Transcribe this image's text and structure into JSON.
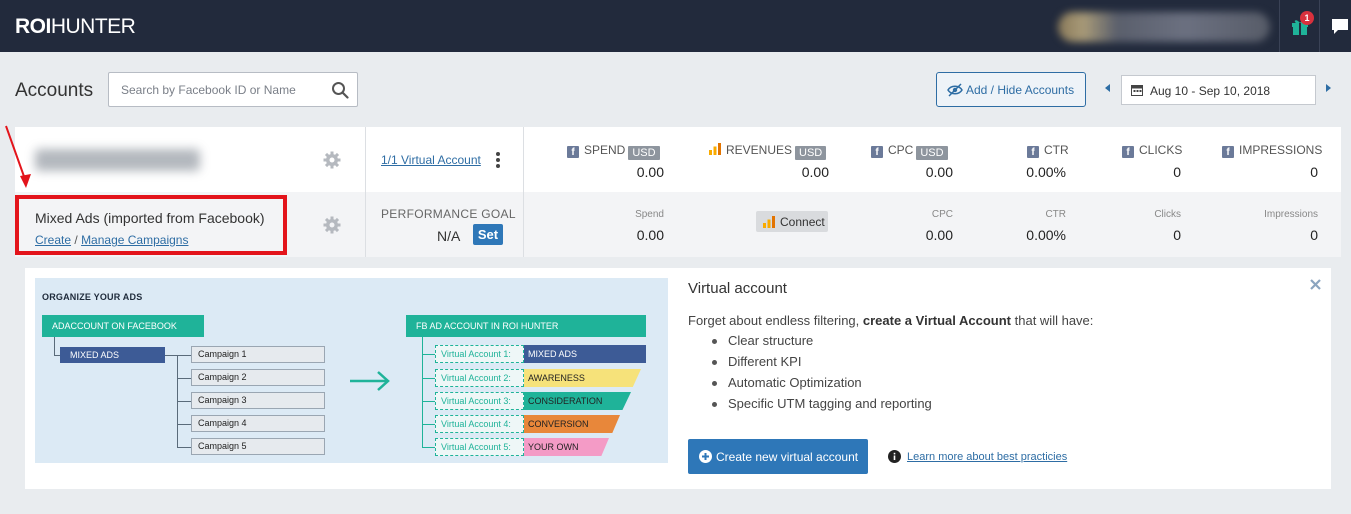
{
  "app": {
    "logo_bold": "ROI",
    "logo_light": "HUNTER",
    "notification_count": "1"
  },
  "toolbar": {
    "title": "Accounts",
    "search_placeholder": "Search by Facebook ID or Name",
    "add_hide_label": "Add / Hide Accounts",
    "date_range": "Aug 10 - Sep 10, 2018"
  },
  "account_row": {
    "virtual_account_link": "1/1 Virtual Account",
    "metrics": [
      {
        "label": "SPEND",
        "source": "facebook",
        "currency": "USD",
        "value": "0.00"
      },
      {
        "label": "REVENUES",
        "source": "analytics",
        "currency": "USD",
        "value": "0.00"
      },
      {
        "label": "CPC",
        "source": "facebook",
        "currency": "USD",
        "value": "0.00"
      },
      {
        "label": "CTR",
        "source": "facebook",
        "value": "0.00%"
      },
      {
        "label": "CLICKS",
        "source": "facebook",
        "value": "0"
      },
      {
        "label": "IMPRESSIONS",
        "source": "facebook",
        "value": "0"
      }
    ]
  },
  "mixed_row": {
    "name": "Mixed Ads (imported from Facebook)",
    "create_link": "Create",
    "separator": "/",
    "manage_link": "Manage Campaigns",
    "performance_goal_label": "PERFORMANCE GOAL",
    "performance_goal_value": "N/A",
    "set_label": "Set",
    "connect_label": "Connect",
    "metrics": [
      {
        "label": "Spend",
        "value": "0.00"
      },
      {
        "label": "CPC",
        "value": "0.00"
      },
      {
        "label": "CTR",
        "value": "0.00%"
      },
      {
        "label": "Clicks",
        "value": "0"
      },
      {
        "label": "Impressions",
        "value": "0"
      }
    ]
  },
  "illustration": {
    "title": "ORGANIZE YOUR ADS",
    "fb_box": "ADACCOUNT ON FACEBOOK",
    "mixed_box": "MIXED ADS",
    "campaigns": [
      "Campaign 1",
      "Campaign 2",
      "Campaign 3",
      "Campaign 4",
      "Campaign 5"
    ],
    "roi_box": "FB AD ACCOUNT IN ROI HUNTER",
    "virtual_accounts": [
      {
        "label": "Virtual Account 1:",
        "tag": "MIXED ADS",
        "color": "#3d5b96",
        "text_color": "#ffffff"
      },
      {
        "label": "Virtual Account 2:",
        "tag": "AWARENESS",
        "color": "#f6e27a",
        "text_color": "#222222"
      },
      {
        "label": "Virtual Account 3:",
        "tag": "CONSIDERATION",
        "color": "#1fb399",
        "text_color": "#222222"
      },
      {
        "label": "Virtual Account 4:",
        "tag": "CONVERSION",
        "color": "#e8873a",
        "text_color": "#222222"
      },
      {
        "label": "Virtual Account 5:",
        "tag": "YOUR OWN",
        "color": "#f49bc6",
        "text_color": "#222222"
      }
    ]
  },
  "promo": {
    "title": "Virtual account",
    "desc_prefix": "Forget about endless filtering, ",
    "desc_bold": "create a Virtual Account",
    "desc_suffix": " that will have:",
    "bullets": [
      "Clear structure",
      "Different KPI",
      "Automatic Optimization",
      "Specific UTM tagging and reporting"
    ],
    "create_button": "Create new virtual account",
    "learn_link": "Learn more about best practicies"
  },
  "colors": {
    "nav_bg": "#222a3c",
    "accent": "#2e77b8",
    "teal": "#1fb399",
    "highlight_red": "#e3141b"
  }
}
